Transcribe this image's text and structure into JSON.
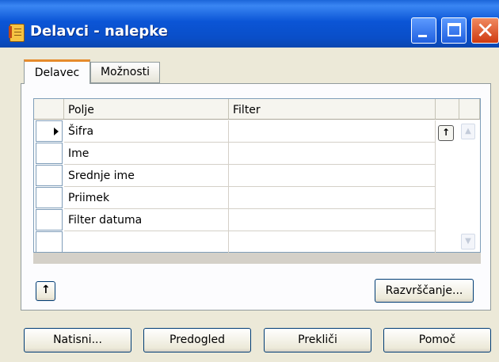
{
  "window": {
    "title": "Delavci - nalepke"
  },
  "tabs": [
    {
      "label": "Delavec",
      "active": true
    },
    {
      "label": "Možnosti",
      "active": false
    }
  ],
  "grid": {
    "columns": [
      "Polje",
      "Filter"
    ],
    "rows": [
      {
        "field": "Šifra",
        "filter": ""
      },
      {
        "field": "Ime",
        "filter": ""
      },
      {
        "field": "Srednje ime",
        "filter": ""
      },
      {
        "field": "Priimek",
        "filter": ""
      },
      {
        "field": "Filter datuma",
        "filter": ""
      },
      {
        "field": "",
        "filter": ""
      }
    ]
  },
  "buttons": {
    "sort": "Razvrščanje...",
    "print": "Natisni...",
    "preview": "Predogled",
    "cancel": "Prekliči",
    "help": "Pomoč"
  },
  "icons": {
    "app": "document-icon",
    "move_up": "arrow-up-icon",
    "minimize": "minimize-icon",
    "maximize": "maximize-icon",
    "close": "close-icon"
  }
}
